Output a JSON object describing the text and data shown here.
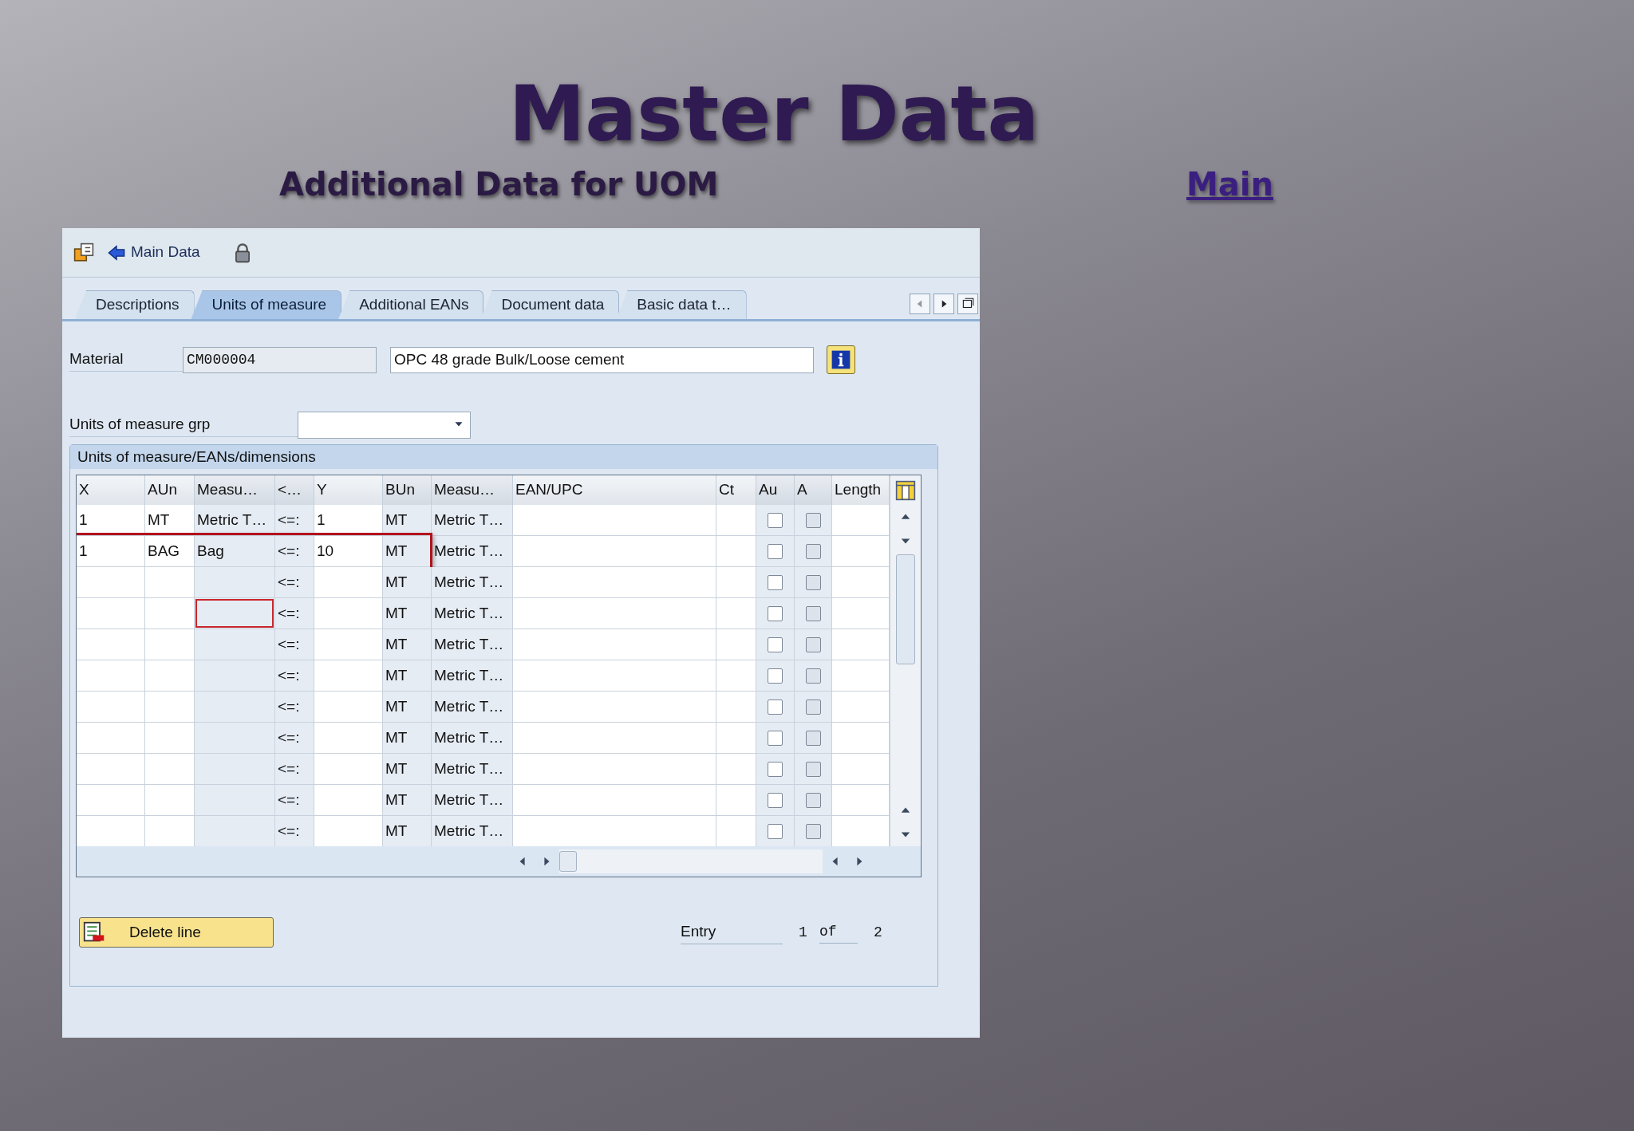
{
  "slide": {
    "title": "Master Data",
    "subtitle": "Additional Data for UOM",
    "link": "Main"
  },
  "toolbar": {
    "button": "Main Data"
  },
  "tabs": [
    {
      "label": "Descriptions",
      "selected": false
    },
    {
      "label": "Units of measure",
      "selected": true
    },
    {
      "label": "Additional EANs",
      "selected": false
    },
    {
      "label": "Document data",
      "selected": false
    },
    {
      "label": "Basic data t…",
      "selected": false
    }
  ],
  "material": {
    "label": "Material",
    "value": "CM000004",
    "description": "OPC 48 grade Bulk/Loose cement"
  },
  "uom_group": {
    "label": "Units of measure grp"
  },
  "group_box": {
    "title": "Units of measure/EANs/dimensions"
  },
  "table": {
    "columns": [
      {
        "label": "X",
        "readonly": false
      },
      {
        "label": "AUn",
        "readonly": false
      },
      {
        "label": "Measu…",
        "readonly": true
      },
      {
        "label": "<…",
        "readonly": true
      },
      {
        "label": "Y",
        "readonly": false
      },
      {
        "label": "BUn",
        "readonly": true
      },
      {
        "label": "Measu…",
        "readonly": true
      },
      {
        "label": "EAN/UPC",
        "readonly": false
      },
      {
        "label": "Ct",
        "readonly": false
      },
      {
        "label": "Au",
        "readonly": true
      },
      {
        "label": "A",
        "readonly": true
      },
      {
        "label": "Length",
        "readonly": false
      }
    ],
    "rows": [
      {
        "cells": [
          "1",
          "MT",
          "Metric T…",
          "<=:",
          "1",
          "MT",
          "Metric T…"
        ],
        "au_checked": false,
        "a_checked": false,
        "highlighted": false,
        "focused": false
      },
      {
        "cells": [
          "1",
          "BAG",
          "Bag",
          "<=:",
          "10",
          "MT",
          "Metric T…"
        ],
        "au_checked": false,
        "a_checked": false,
        "highlighted": true,
        "focused": false
      },
      {
        "cells": [
          null,
          null,
          null,
          "<=:",
          null,
          "MT",
          "Metric T…"
        ],
        "au_checked": false,
        "a_checked": false,
        "highlighted": false,
        "focused": false
      },
      {
        "cells": [
          null,
          null,
          null,
          "<=:",
          null,
          "MT",
          "Metric T…"
        ],
        "au_checked": false,
        "a_checked": false,
        "highlighted": false,
        "focused": true
      },
      {
        "cells": [
          null,
          null,
          null,
          "<=:",
          null,
          "MT",
          "Metric T…"
        ],
        "au_checked": false,
        "a_checked": false,
        "highlighted": false,
        "focused": false
      },
      {
        "cells": [
          null,
          null,
          null,
          "<=:",
          null,
          "MT",
          "Metric T…"
        ],
        "au_checked": false,
        "a_checked": false,
        "highlighted": false,
        "focused": false
      },
      {
        "cells": [
          null,
          null,
          null,
          "<=:",
          null,
          "MT",
          "Metric T…"
        ],
        "au_checked": false,
        "a_checked": false,
        "highlighted": false,
        "focused": false
      },
      {
        "cells": [
          null,
          null,
          null,
          "<=:",
          null,
          "MT",
          "Metric T…"
        ],
        "au_checked": false,
        "a_checked": false,
        "highlighted": false,
        "focused": false
      },
      {
        "cells": [
          null,
          null,
          null,
          "<=:",
          null,
          "MT",
          "Metric T…"
        ],
        "au_checked": false,
        "a_checked": false,
        "highlighted": false,
        "focused": false
      },
      {
        "cells": [
          null,
          null,
          null,
          "<=:",
          null,
          "MT",
          "Metric T…"
        ],
        "au_checked": false,
        "a_checked": false,
        "highlighted": false,
        "focused": false
      },
      {
        "cells": [
          null,
          null,
          null,
          "<=:",
          null,
          "MT",
          "Metric T…"
        ],
        "au_checked": false,
        "a_checked": false,
        "highlighted": false,
        "focused": false
      }
    ]
  },
  "footer": {
    "button": "Delete line",
    "entry_label": "Entry",
    "entry": "1",
    "of": "of",
    "total": "2"
  }
}
